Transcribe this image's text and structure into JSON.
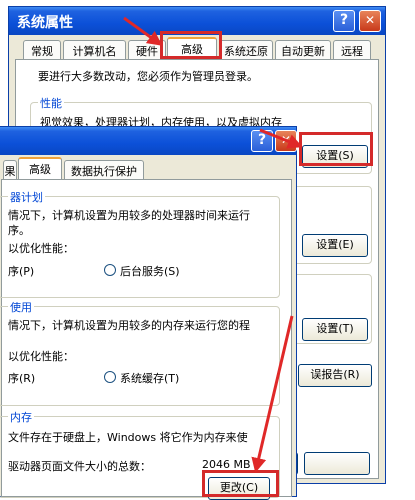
{
  "back_window": {
    "title": "系统属性",
    "help": "?",
    "close": "✕",
    "tabs": [
      "常规",
      "计算机名",
      "硬件",
      "高级",
      "系统还原",
      "自动更新",
      "远程"
    ],
    "admin_note": "要进行大多数改动，您必须作为管理员登录。",
    "performance_title": "性能",
    "performance_desc": "视觉效果，处理器计划，内存使用，以及虚拟内存",
    "settings_btn_1": "设置(S)",
    "settings_btn_2": "设置(E)",
    "settings_btn_3": "设置(T)",
    "error_report_btn": "误报告(R)"
  },
  "front_window": {
    "help": "?",
    "close": "✕",
    "tabs": [
      "果",
      "高级",
      "数据执行保护"
    ],
    "cpu_title": "器计划",
    "cpu_desc": "情况下，计算机设置为用较多的处理器时间来运行",
    "cpu_desc2": "序。",
    "cpu_opt_label": "以优化性能：",
    "cpu_opt_programs": "序(P)",
    "cpu_opt_background": "后台服务(S)",
    "mem_title": "使用",
    "mem_desc": "情况下，计算机设置为用较多的内存来运行您的程",
    "mem_opt_label": "以优化性能：",
    "mem_opt_programs": "序(R)",
    "mem_opt_cache": "系统缓存(T)",
    "vm_title": "内存",
    "vm_desc": "文件存在于硬盘上，Windows 将它作为内存来使",
    "vm_total_label": "驱动器页面文件大小的总数：",
    "vm_total_value": "2046 MB",
    "change_btn": "更改(C)"
  },
  "colors": {
    "titlebar": "#0b50d8",
    "highlight_box": "#d42a2a",
    "group_title": "#0046d5"
  }
}
